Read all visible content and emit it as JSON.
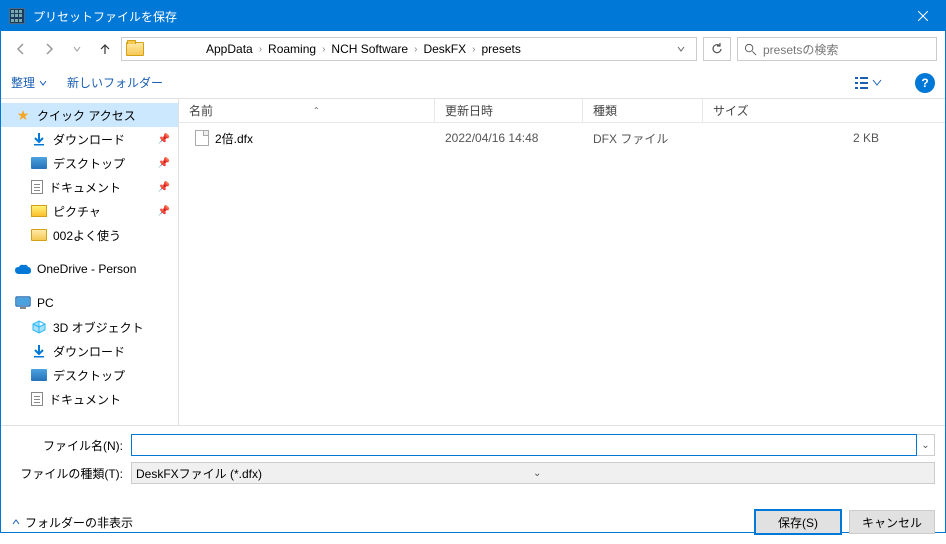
{
  "window": {
    "title": "プリセットファイルを保存"
  },
  "breadcrumb": {
    "segments": [
      "AppData",
      "Roaming",
      "NCH Software",
      "DeskFX",
      "presets"
    ]
  },
  "search": {
    "placeholder": "presetsの検索"
  },
  "toolbar": {
    "organize": "整理",
    "new_folder": "新しいフォルダー"
  },
  "sidebar": {
    "quick_access": "クイック アクセス",
    "downloads": "ダウンロード",
    "desktop": "デスクトップ",
    "documents": "ドキュメント",
    "pictures": "ピクチャ",
    "custom_folder": "002よく使う",
    "onedrive": "OneDrive - Person",
    "pc": "PC",
    "objects_3d": "3D オブジェクト",
    "downloads2": "ダウンロード",
    "desktop2": "デスクトップ",
    "documents2": "ドキュメント"
  },
  "columns": {
    "name": "名前",
    "date": "更新日時",
    "type": "種類",
    "size": "サイズ"
  },
  "files": [
    {
      "name": "2倍.dfx",
      "date": "2022/04/16 14:48",
      "type": "DFX ファイル",
      "size": "2 KB"
    }
  ],
  "bottom": {
    "filename_label": "ファイル名(N):",
    "filename_value": "",
    "filetype_label": "ファイルの種類(T):",
    "filetype_value": "DeskFXファイル (*.dfx)"
  },
  "footer": {
    "hide_folders": "フォルダーの非表示",
    "save": "保存(S)",
    "cancel": "キャンセル"
  }
}
